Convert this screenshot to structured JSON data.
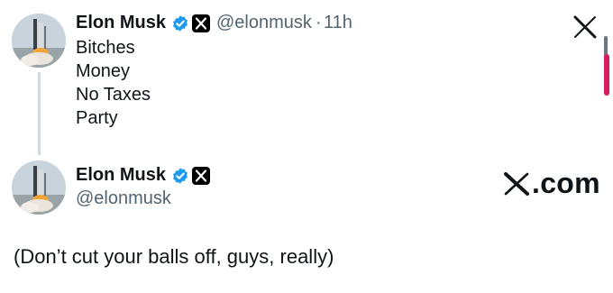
{
  "post": {
    "author_name": "Elon Musk",
    "handle": "@elonmusk",
    "separator": "·",
    "time": "11h",
    "lines": [
      "Bitches",
      "Money",
      "No Taxes",
      "Party"
    ]
  },
  "profile": {
    "author_name": "Elon Musk",
    "handle": "@elonmusk"
  },
  "brand": {
    "site_label": ".com"
  },
  "caption": {
    "text": "(Don’t cut your balls off, guys, really)"
  },
  "icons": {
    "verified": "verified-badge-icon",
    "x_mark": "x-logo-icon"
  },
  "colors": {
    "verified_blue": "#1d9bf0",
    "secondary_text": "#536471",
    "scroll_accent": "#d81b60"
  }
}
